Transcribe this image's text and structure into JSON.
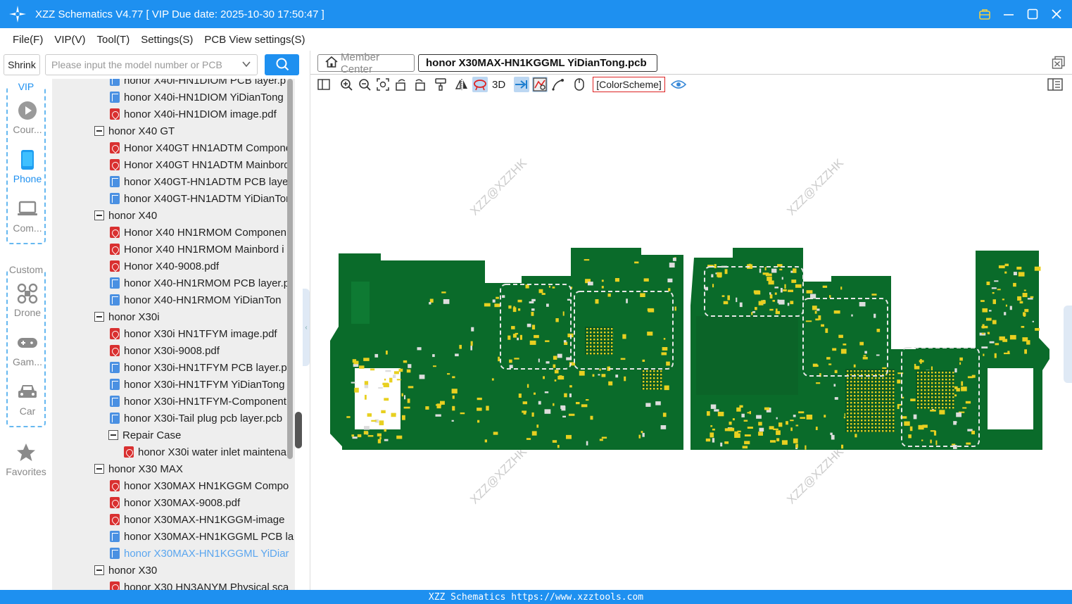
{
  "titlebar": {
    "title": "XZZ Schematics V4.77 [ VIP Due date: 2025-10-30 17:50:47 ]"
  },
  "menu": [
    "File(F)",
    "VIP(V)",
    "Tool(T)",
    "Settings(S)",
    "PCB View settings(S)"
  ],
  "left_rail": {
    "shrink_label": "Shrink",
    "vip_label": "VIP",
    "custom_label": "Custom",
    "items": [
      "Cour...",
      "Phone",
      "Com...",
      "Drone",
      "Gam...",
      "Car",
      "Favorites"
    ]
  },
  "search": {
    "placeholder": "Please input the model number or PCB"
  },
  "tree": [
    {
      "label": "honor X40i-HN1DIOM PCB layer.p",
      "icon": "pcb"
    },
    {
      "label": "honor X40i-HN1DIOM YiDianTong",
      "icon": "pcb"
    },
    {
      "label": "honor X40i-HN1DIOM image.pdf",
      "icon": "pdf"
    },
    {
      "label": "honor X40 GT",
      "icon": "folder"
    },
    {
      "label": "Honor X40GT HN1ADTM Compone",
      "icon": "pdf"
    },
    {
      "label": "Honor X40GT HN1ADTM Mainbord",
      "icon": "pdf"
    },
    {
      "label": "honor X40GT-HN1ADTM PCB layer",
      "icon": "pcb"
    },
    {
      "label": "honor X40GT-HN1ADTM YiDianTon",
      "icon": "pcb"
    },
    {
      "label": "honor X40",
      "icon": "folder"
    },
    {
      "label": "Honor X40 HN1RMOM Componen",
      "icon": "pdf"
    },
    {
      "label": "Honor X40 HN1RMOM Mainbord i",
      "icon": "pdf"
    },
    {
      "label": "Honor X40-9008.pdf",
      "icon": "pdf"
    },
    {
      "label": "honor X40-HN1RMOM PCB layer.p",
      "icon": "pcb"
    },
    {
      "label": "honor X40-HN1RMOM YiDianTon",
      "icon": "pcb"
    },
    {
      "label": "honor X30i",
      "icon": "folder"
    },
    {
      "label": "honor X30i HN1TFYM image.pdf",
      "icon": "pdf"
    },
    {
      "label": "honor X30i-9008.pdf",
      "icon": "pdf"
    },
    {
      "label": "honor X30i-HN1TFYM PCB layer.pc",
      "icon": "pcb"
    },
    {
      "label": "honor X30i-HN1TFYM YiDianTong",
      "icon": "pcb"
    },
    {
      "label": "honor X30i-HN1TFYM-Component",
      "icon": "pcb"
    },
    {
      "label": "honor X30i-Tail plug pcb layer.pcb",
      "icon": "pcb"
    },
    {
      "label": "Repair Case",
      "icon": "folder"
    },
    {
      "label": "honor X30i water inlet maintena",
      "icon": "pdf"
    },
    {
      "label": "honor X30 MAX",
      "icon": "folder"
    },
    {
      "label": "honor X30MAX HN1KGGM Compo",
      "icon": "pdf"
    },
    {
      "label": "honor X30MAX-9008.pdf",
      "icon": "pdf"
    },
    {
      "label": "honor X30MAX-HN1KGGM-image",
      "icon": "pdf"
    },
    {
      "label": "honor X30MAX-HN1KGGML PCB la",
      "icon": "pcb"
    },
    {
      "label": "honor X30MAX-HN1KGGML YiDiar",
      "icon": "pcb"
    },
    {
      "label": "honor X30",
      "icon": "folder"
    },
    {
      "label": "honor X30 HN3ANYM Physical sca",
      "icon": "pdf"
    }
  ],
  "tabs": {
    "member_center": "Member Center",
    "active_file": "honor X30MAX-HN1KGGML YiDianTong.pcb"
  },
  "toolbar": {
    "three_d": "3D",
    "color_scheme": "[ColorScheme]"
  },
  "canvas": {
    "watermark": "XZZ@XZZHK",
    "board_color": "#0a6b2a",
    "pad_color": "#e8d020"
  },
  "statusbar": {
    "text": "XZZ Schematics https://www.xzztools.com"
  }
}
